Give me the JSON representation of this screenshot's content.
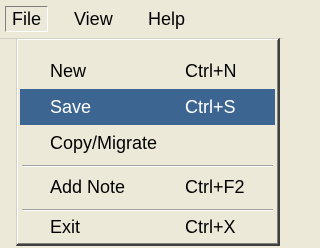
{
  "menubar": {
    "items": [
      {
        "label": "File"
      },
      {
        "label": "View"
      },
      {
        "label": "Help"
      }
    ]
  },
  "file_menu": {
    "items": [
      {
        "label": "New",
        "shortcut": "Ctrl+N"
      },
      {
        "label": "Save",
        "shortcut": "Ctrl+S"
      },
      {
        "label": "Copy/Migrate",
        "shortcut": ""
      },
      {
        "label": "Add Note",
        "shortcut": "Ctrl+F2"
      },
      {
        "label": "Exit",
        "shortcut": "Ctrl+X"
      }
    ],
    "selected_label": "Save"
  },
  "colors": {
    "background": "#ece9d8",
    "highlight": "#3c6592",
    "highlight_text": "#ffffff"
  }
}
